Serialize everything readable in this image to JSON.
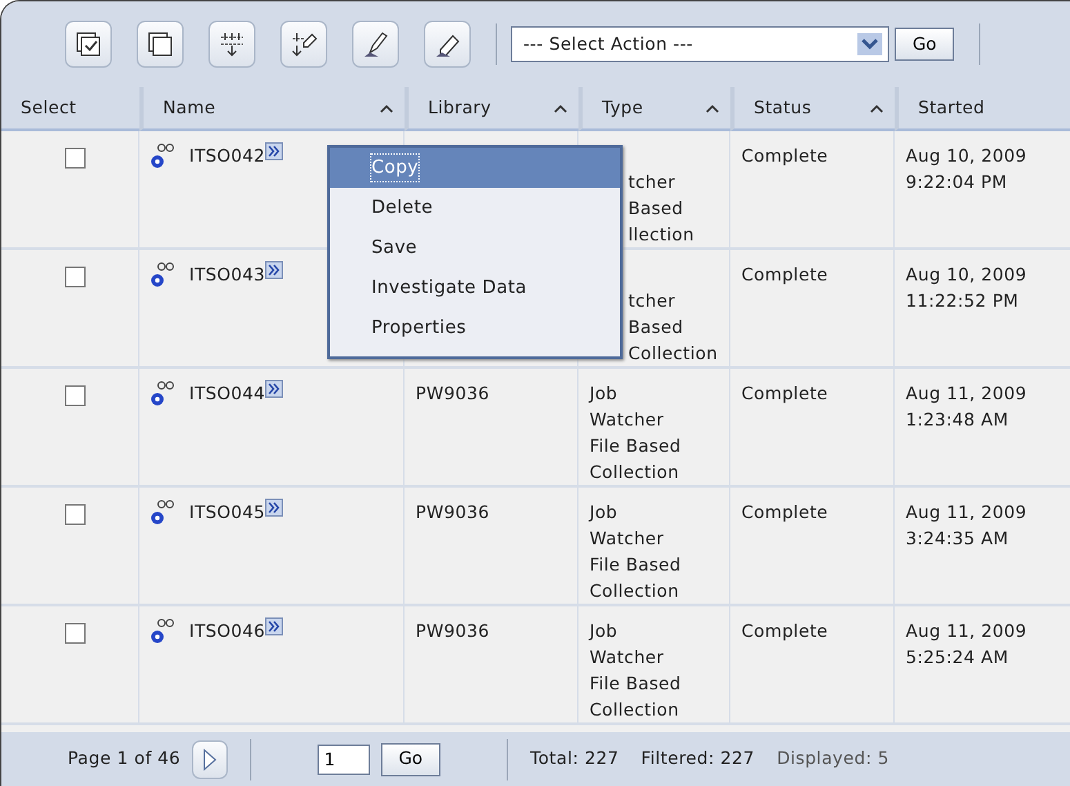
{
  "toolbar": {
    "action_select": "--- Select Action ---",
    "go": "Go"
  },
  "columns": [
    {
      "label": "Select",
      "sortable": false
    },
    {
      "label": "Name",
      "sortable": true
    },
    {
      "label": "Library",
      "sortable": true
    },
    {
      "label": "Type",
      "sortable": true
    },
    {
      "label": "Status",
      "sortable": true
    },
    {
      "label": "Started",
      "sortable": false
    }
  ],
  "rows": [
    {
      "checked": false,
      "name": "ITSO042",
      "library": "",
      "menu_covers": true,
      "type": [
        "tcher",
        "Based",
        "llection"
      ],
      "status": "Complete",
      "started": [
        "Aug 10, 2009",
        "9:22:04 PM"
      ]
    },
    {
      "checked": false,
      "name": "ITSO043",
      "library": "",
      "menu_covers": true,
      "type": [
        "tcher",
        "Based",
        "Collection"
      ],
      "status": "Complete",
      "started": [
        "Aug 10, 2009",
        "11:22:52 PM"
      ]
    },
    {
      "checked": false,
      "name": "ITSO044",
      "library": "PW9036",
      "menu_covers": false,
      "type": [
        "Job",
        "Watcher",
        "File Based",
        "Collection"
      ],
      "status": "Complete",
      "started": [
        "Aug 11, 2009",
        "1:23:48 AM"
      ]
    },
    {
      "checked": false,
      "name": "ITSO045",
      "library": "PW9036",
      "menu_covers": false,
      "type": [
        "Job",
        "Watcher",
        "File Based",
        "Collection"
      ],
      "status": "Complete",
      "started": [
        "Aug 11, 2009",
        "3:24:35 AM"
      ]
    },
    {
      "checked": false,
      "name": "ITSO046",
      "library": "PW9036",
      "menu_covers": false,
      "type": [
        "Job",
        "Watcher",
        "File Based",
        "Collection"
      ],
      "status": "Complete",
      "started": [
        "Aug 11, 2009",
        "5:25:24 AM"
      ]
    }
  ],
  "context_menu": [
    {
      "label": "Copy",
      "selected": true
    },
    {
      "label": "Delete",
      "selected": false
    },
    {
      "label": "Save",
      "selected": false
    },
    {
      "label": "Investigate Data",
      "selected": false
    },
    {
      "label": "Properties",
      "selected": false
    }
  ],
  "footer": {
    "page": "Page 1 of 46",
    "page_input": "1",
    "go": "Go",
    "total": "Total: 227",
    "filtered": "Filtered: 227",
    "displayed": "Displayed: 5"
  }
}
